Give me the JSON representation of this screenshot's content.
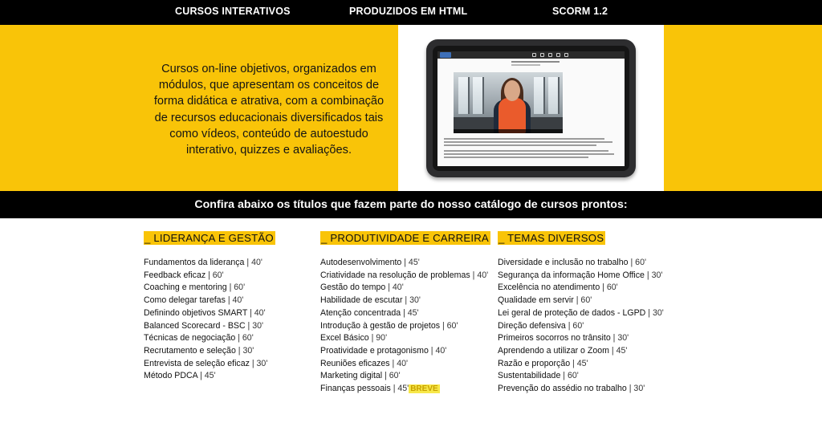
{
  "nav": {
    "items": [
      "CURSOS INTERATIVOS",
      "PRODUZIDOS EM HTML",
      "SCORM 1.2"
    ]
  },
  "hero": {
    "description": "Cursos on-line objetivos, organizados em módulos, que apresentam os conceitos de forma didática e atrativa, com a combinação de recursos educacionais diversificados tais como vídeos, conteúdo de autoestudo interativo, quizzes e avaliações."
  },
  "catalog": {
    "banner": "Confira abaixo os títulos que fazem parte do nosso catálogo de cursos prontos:",
    "columns": [
      {
        "title": "_ LIDERANÇA E GESTÃO",
        "courses": [
          {
            "name": "Fundamentos da liderança",
            "duration": " | 40'"
          },
          {
            "name": "Feedback eficaz",
            "duration": " | 60'"
          },
          {
            "name": "Coaching e mentoring",
            "duration": " | 60'"
          },
          {
            "name": "Como delegar tarefas",
            "duration": " | 40'"
          },
          {
            "name": "Definindo objetivos SMART",
            "duration": " | 40'"
          },
          {
            "name": "Balanced Scorecard - BSC",
            "duration": " | 30'"
          },
          {
            "name": "Técnicas de negociação",
            "duration": " | 60'"
          },
          {
            "name": "Recrutamento e seleção",
            "duration": " | 30'"
          },
          {
            "name": "Entrevista de seleção eficaz",
            "duration": " | 30'"
          },
          {
            "name": "Método PDCA",
            "duration": " | 45'"
          }
        ]
      },
      {
        "title": "_ PRODUTIVIDADE E CARREIRA",
        "courses": [
          {
            "name": "Autodesenvolvimento",
            "duration": " | 45'"
          },
          {
            "name": "Criatividade na resolução de problemas",
            "duration": " | 40'"
          },
          {
            "name": "Gestão do tempo",
            "duration": " | 40'"
          },
          {
            "name": "Habilidade de escutar",
            "duration": " | 30'"
          },
          {
            "name": "Atenção concentrada",
            "duration": " | 45'"
          },
          {
            "name": "Introdução à gestão de projetos",
            "duration": " | 60'"
          },
          {
            "name": "Excel Básico",
            "duration": " | 90'"
          },
          {
            "name": "Proatividade e protagonismo",
            "duration": " | 40'"
          },
          {
            "name": "Reuniões eficazes",
            "duration": " | 40'"
          },
          {
            "name": "Marketing digital",
            "duration": " | 60'"
          },
          {
            "name": "Finanças pessoais",
            "duration": " | 45'",
            "badge": "BREVE"
          }
        ]
      },
      {
        "title": "_ TEMAS DIVERSOS",
        "courses": [
          {
            "name": "Diversidade e inclusão no trabalho",
            "duration": " | 60'"
          },
          {
            "name": "Segurança da informação Home Office",
            "duration": " | 30'"
          },
          {
            "name": "Excelência no atendimento",
            "duration": " | 60'"
          },
          {
            "name": "Qualidade em servir",
            "duration": " | 60'"
          },
          {
            "name": "Lei geral de proteção de dados - LGPD",
            "duration": " | 30'"
          },
          {
            "name": "Direção defensiva",
            "duration": " | 60'"
          },
          {
            "name": "Primeiros socorros no trânsito",
            "duration": " | 30'"
          },
          {
            "name": "Aprendendo a utilizar o Zoom",
            "duration": " | 45'"
          },
          {
            "name": "Razão e proporção",
            "duration": " | 45'"
          },
          {
            "name": "Sustentabilidade",
            "duration": " | 60'"
          },
          {
            "name": "Prevenção do assédio no trabalho",
            "duration": " | 30'"
          }
        ]
      }
    ]
  },
  "colors": {
    "accent_yellow": "#f9c408",
    "nav_background": "#000000",
    "breve_badge": "#f7e84a"
  }
}
